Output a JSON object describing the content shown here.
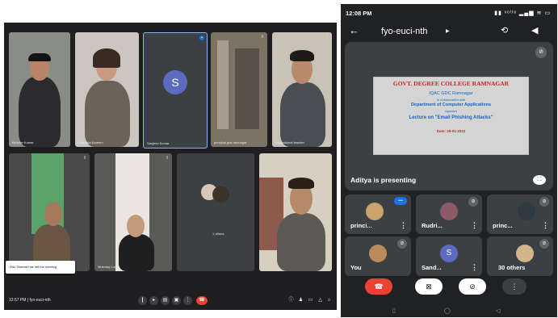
{
  "desktop": {
    "meeting_code": "fyo-euci-nth",
    "time": "12:57 PM",
    "tiles": [
      {
        "name": "Birinder Kumar"
      },
      {
        "name": "Shahista Kareem"
      },
      {
        "name": "Sanjeev Kumar",
        "avatar_letter": "S"
      },
      {
        "name": "principal gdc ramnagar"
      },
      {
        "name": "inspirational teacher"
      },
      {
        "name": ""
      },
      {
        "name": "Mushtaq Lodhi"
      },
      {
        "name": "1 others"
      },
      {
        "name": ""
      }
    ],
    "toast": "Ritu Sharma has left the meeting",
    "controls": [
      "mic-icon",
      "camera-icon",
      "captions-icon",
      "present-icon",
      "more-icon",
      "end-call-icon"
    ],
    "right_icons": [
      "info-icon",
      "people-icon",
      "chat-icon",
      "activities-icon",
      "lock-icon"
    ]
  },
  "phone": {
    "status_time": "12:08 PM",
    "status_right": "▮▮ ᵛᵒˡᵗᵉ ▂▄▆ ≋ ▭",
    "meeting_code": "fyo-euci-nth",
    "presenting_label": "Aditya is presenting",
    "slide": {
      "title": "GOVT. DEGREE COLLEGE RAMNAGAR",
      "line1": "IQAC GDC Ramnagar",
      "line2": "In collaboration with",
      "line3": "Department of Computer Applications",
      "line4": "organises",
      "line5": "Lecture on \"Email Phishing Attacks\"",
      "date": "Date: 29-01-2022"
    },
    "participants": [
      {
        "name": "princi...",
        "speaking": true
      },
      {
        "name": "Rudri..."
      },
      {
        "name": "princ..."
      },
      {
        "name": "You"
      },
      {
        "name": "Sand...",
        "avatar_letter": "S"
      },
      {
        "name": "30 others"
      }
    ],
    "colors": {
      "accent": "#1a73e8",
      "end_call": "#ea4335",
      "tile": "#3c4043",
      "background": "#202124"
    }
  }
}
